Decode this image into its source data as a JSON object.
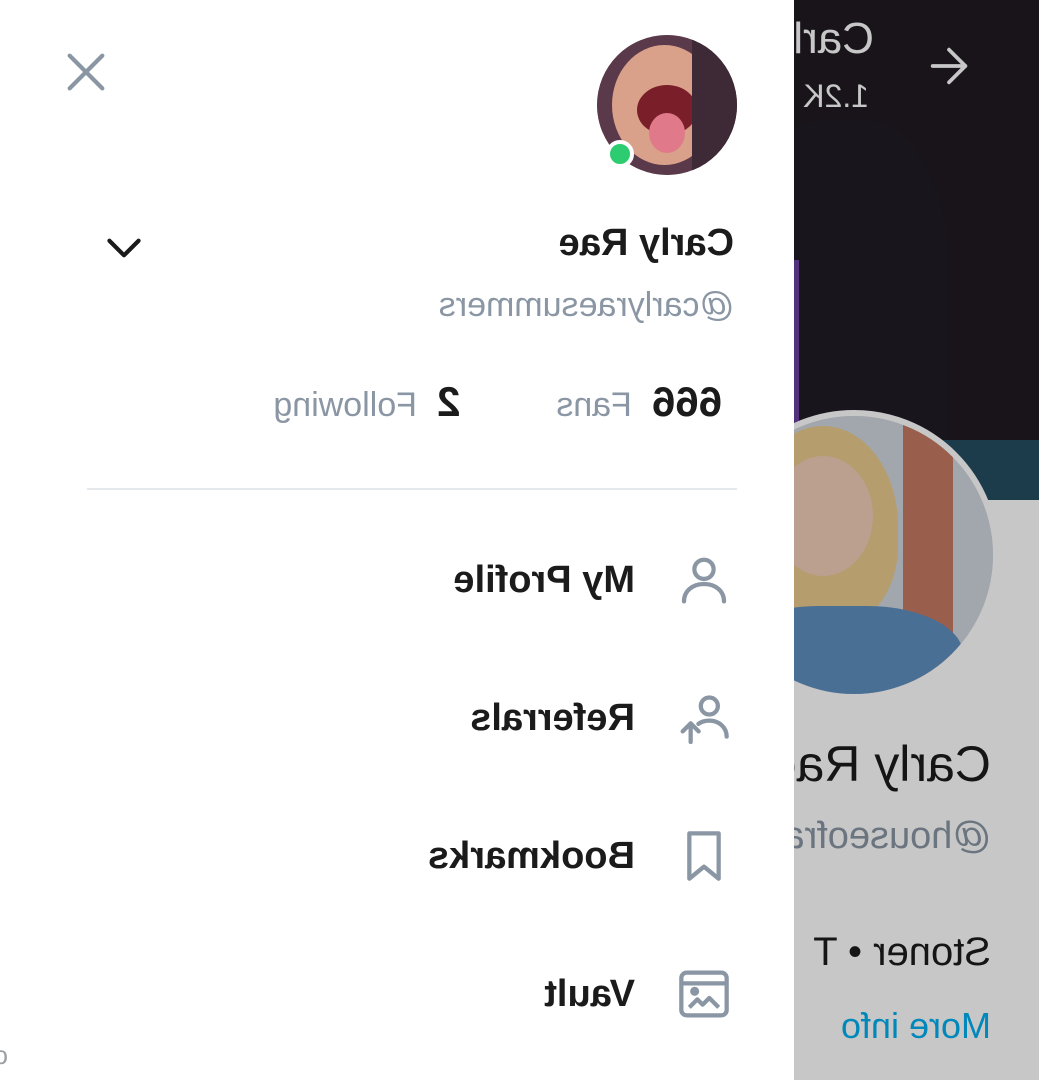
{
  "drawer": {
    "display_name": "Carly Rae",
    "handle": "@carlyraesummers",
    "stats": {
      "fans_value": "666",
      "fans_label": "Fans",
      "following_value": "2",
      "following_label": "Following"
    },
    "menu": [
      {
        "label": "My Profile",
        "icon": "person-icon"
      },
      {
        "label": "Referrals",
        "icon": "referral-icon"
      },
      {
        "label": "Bookmarks",
        "icon": "bookmark-icon"
      },
      {
        "label": "Vault",
        "icon": "vault-icon"
      }
    ],
    "online_status_color": "#2ecc71"
  },
  "background_profile": {
    "cover_name": "Carly Rae",
    "cover_count": "1.2K",
    "name": "Carly Rae",
    "handle": "@houseofrae",
    "bio": "Stoner • T",
    "more_info": "More info",
    "link_color": "#00aff0"
  },
  "watermark": "carlyraesummers",
  "colors": {
    "muted_text": "#8a96a3",
    "primary_text": "#1b1b1b",
    "divider": "#e6e9ec"
  }
}
